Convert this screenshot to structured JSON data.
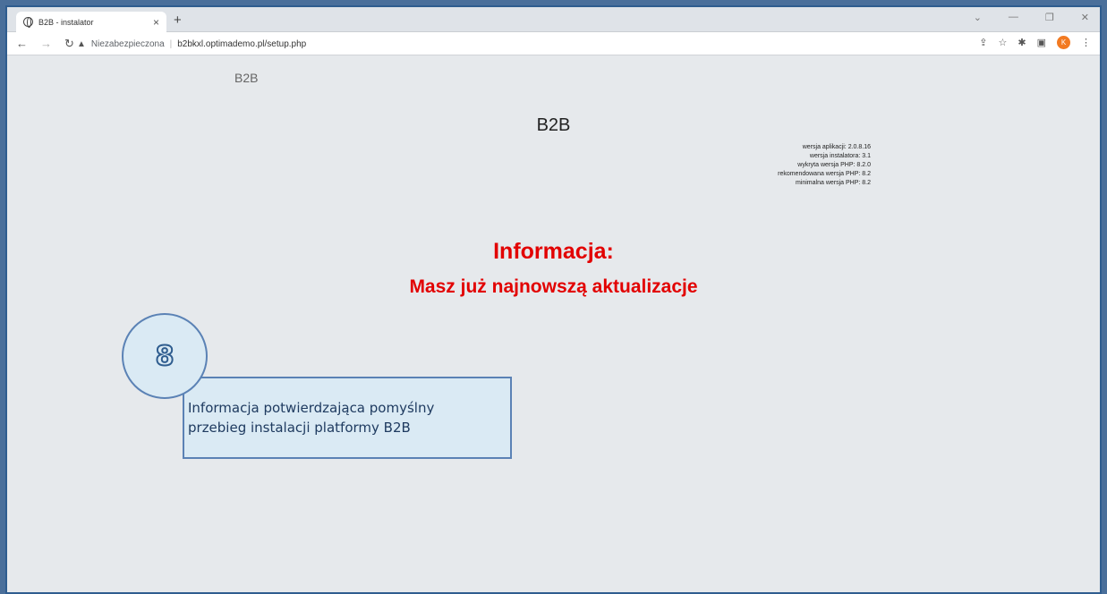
{
  "browser": {
    "tab_title": "B2B - instalator",
    "tab_close": "×",
    "new_tab": "+",
    "security_label": "Niezabezpieczona",
    "url": "b2bkxl.optimademo.pl/setup.php",
    "avatar_letter": "K"
  },
  "page": {
    "logo_text": "B2B",
    "heading": "B2B",
    "versions": [
      "wersja aplikacji: 2.0.8.16",
      "wersja instalatora: 3.1",
      "wykryta wersja PHP: 8.2.0",
      "rekomendowana wersja PHP: 8.2",
      "minimalna wersja PHP: 8.2"
    ],
    "info_title": "Informacja:",
    "info_message": "Masz już najnowszą aktualizacje"
  },
  "callout": {
    "number": "8",
    "line1": "Informacja potwierdzająca pomyślny",
    "line2": "przebieg instalacji platformy B2B"
  }
}
